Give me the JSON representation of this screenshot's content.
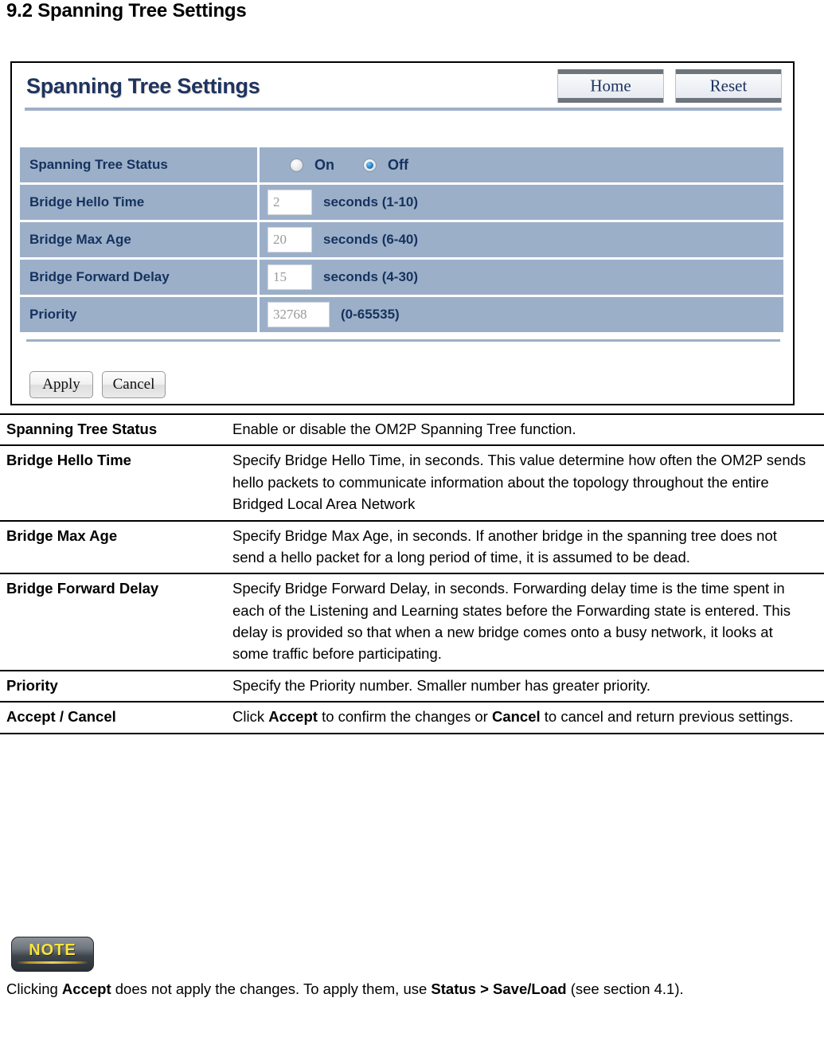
{
  "section": {
    "heading": "9.2 Spanning Tree Settings"
  },
  "device_panel": {
    "title": "Spanning Tree Settings",
    "header_buttons": [
      {
        "label": "Home"
      },
      {
        "label": "Reset"
      }
    ],
    "rows": [
      {
        "label": "Spanning Tree Status",
        "control": "radio",
        "options": [
          {
            "label": "On",
            "selected": false
          },
          {
            "label": "Off",
            "selected": true
          }
        ]
      },
      {
        "label": "Bridge Hello Time",
        "control": "text",
        "value": "2",
        "unit": "seconds (1-10)"
      },
      {
        "label": "Bridge Max Age",
        "control": "text",
        "value": "20",
        "unit": "seconds (6-40)"
      },
      {
        "label": "Bridge Forward Delay",
        "control": "text",
        "value": "15",
        "unit": "seconds (4-30)"
      },
      {
        "label": "Priority",
        "control": "text",
        "value": "32768",
        "unit": "(0-65535)"
      }
    ],
    "footer_buttons": [
      {
        "label": "Apply"
      },
      {
        "label": "Cancel"
      }
    ]
  },
  "description_table": {
    "rows": [
      {
        "term": "Spanning Tree Status",
        "description": "Enable or disable the OM2P Spanning Tree function."
      },
      {
        "term": "Bridge Hello Time",
        "description": "Specify Bridge Hello Time, in seconds. This value determine how often the OM2P sends hello packets to communicate information about the topology throughout the entire Bridged Local Area Network"
      },
      {
        "term": "Bridge Max Age",
        "description": "Specify Bridge Max Age, in seconds. If another bridge in the spanning tree does not send a hello packet for a long period of time, it is assumed to be dead."
      },
      {
        "term": "Bridge Forward Delay",
        "description": "Specify Bridge Forward Delay, in seconds. Forwarding delay time is the time spent in each of the Listening and Learning states before the Forwarding state is entered. This delay is provided so that when a new bridge comes onto a busy network, it looks at some traffic before participating."
      },
      {
        "term": "Priority",
        "description": "Specify the Priority number. Smaller number has greater priority."
      },
      {
        "term": "Accept / Cancel",
        "description_parts": [
          {
            "text": "Click ",
            "bold": false
          },
          {
            "text": "Accept",
            "bold": true
          },
          {
            "text": " to confirm the changes or ",
            "bold": false
          },
          {
            "text": "Cancel",
            "bold": true
          },
          {
            "text": " to cancel and return previous settings.",
            "bold": false
          }
        ]
      }
    ]
  },
  "note": {
    "badge_label": "NOTE",
    "body_parts": [
      {
        "text": "Clicking ",
        "bold": false
      },
      {
        "text": "Accept",
        "bold": true
      },
      {
        "text": " does not apply the changes. To apply them, use ",
        "bold": false
      },
      {
        "text": "Status > Save/Load",
        "bold": true
      },
      {
        "text": " (see section 4.1).",
        "bold": false
      }
    ]
  },
  "colors": {
    "row_blue": "#9cafc8",
    "title_blue": "#1d3461",
    "note_yellow": "#f7e53b",
    "rule_blue": "#9fb0c8"
  }
}
